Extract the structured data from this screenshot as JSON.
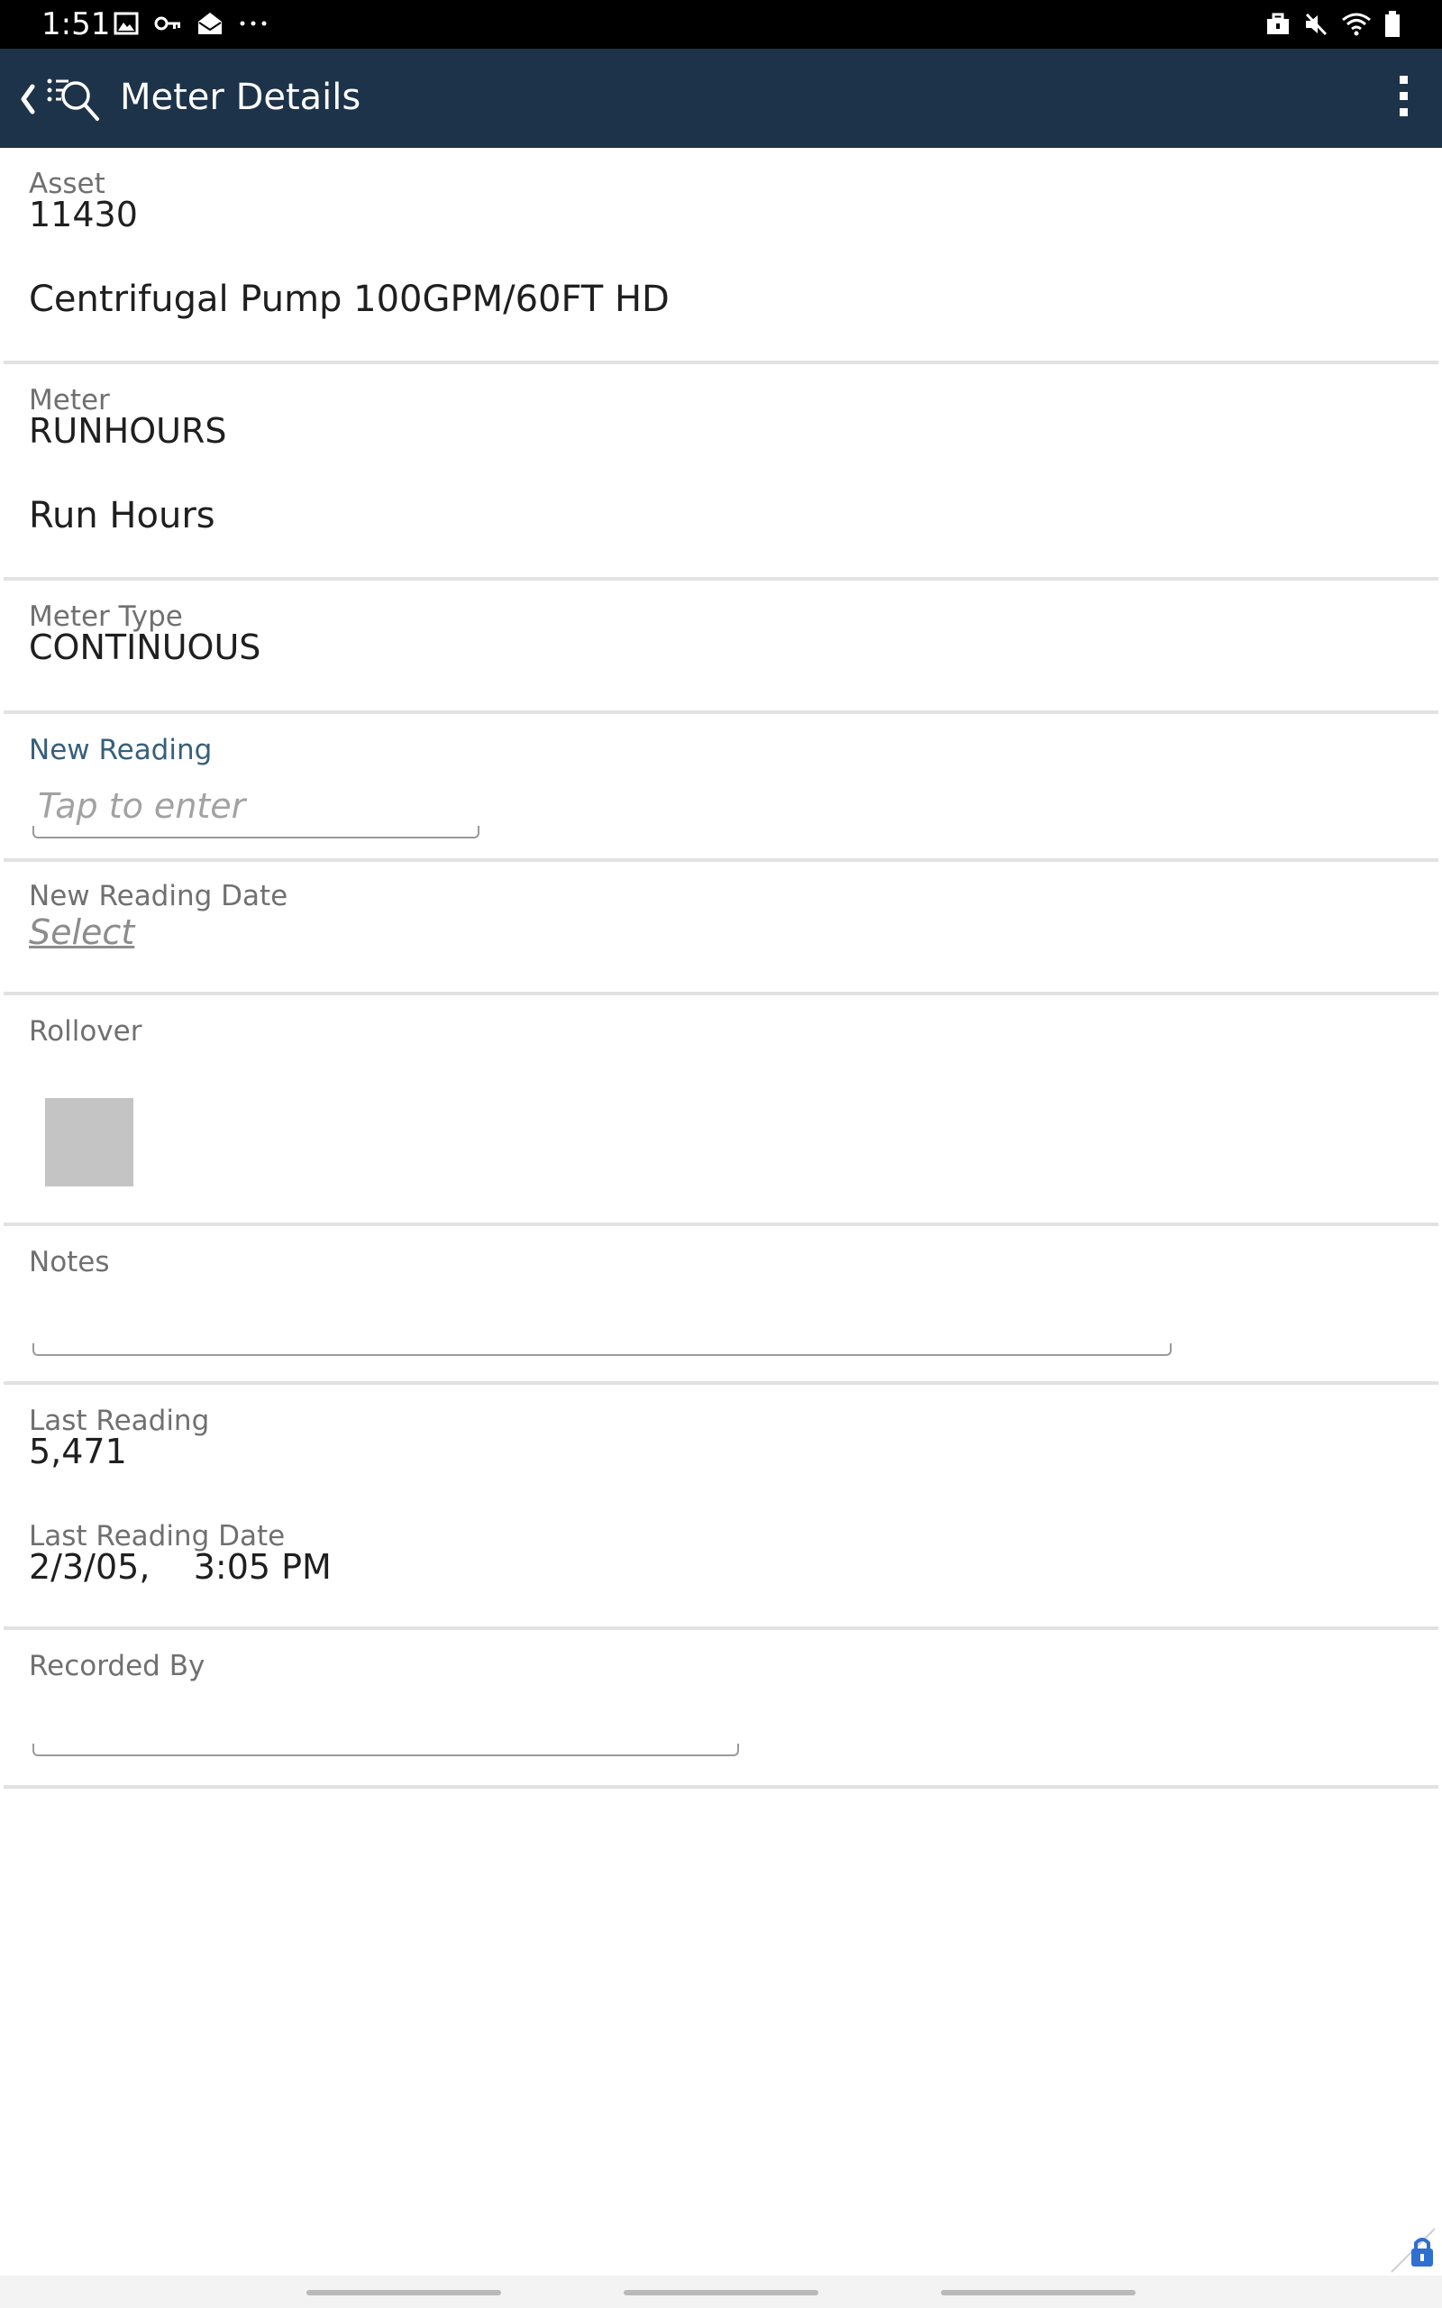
{
  "status_bar": {
    "time": "1:51",
    "left_icons": [
      "image-icon",
      "key-icon",
      "mail-open-icon",
      "more-dots-icon"
    ],
    "right_icons": [
      "briefcase-icon",
      "mute-icon",
      "wifi-icon",
      "battery-icon"
    ]
  },
  "app_bar": {
    "title": "Meter Details",
    "colors": {
      "background": "#1d3349",
      "text": "#ffffff"
    }
  },
  "asset": {
    "label": "Asset",
    "value": "11430",
    "description": "Centrifugal Pump 100GPM/60FT HD"
  },
  "meter": {
    "label": "Meter",
    "value": "RUNHOURS",
    "description": "Run Hours"
  },
  "meter_type": {
    "label": "Meter Type",
    "value": "CONTINUOUS"
  },
  "new_reading": {
    "label": "New Reading",
    "placeholder": "Tap to enter"
  },
  "new_reading_date": {
    "label": "New Reading Date",
    "value": "Select"
  },
  "rollover": {
    "label": "Rollover",
    "checked": false
  },
  "notes": {
    "label": "Notes",
    "value": ""
  },
  "last_reading": {
    "label": "Last Reading",
    "value": "5,471",
    "date_label": "Last Reading Date",
    "date_value": "2/3/05,    3:05 PM"
  },
  "recorded_by": {
    "label": "Recorded By",
    "value": ""
  }
}
